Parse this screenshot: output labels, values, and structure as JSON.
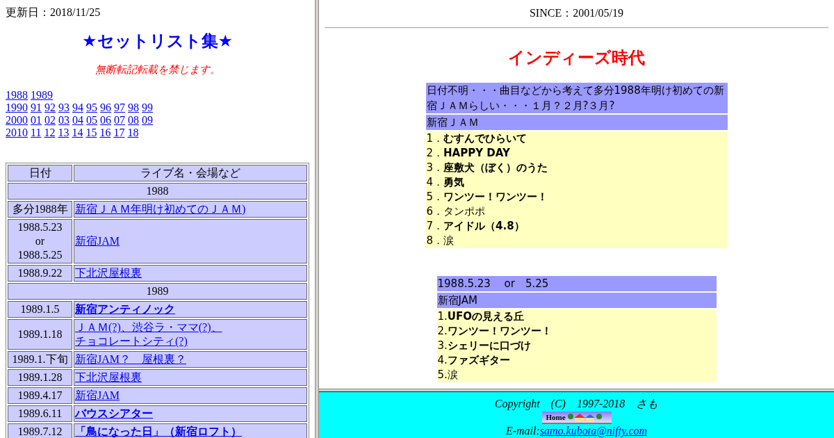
{
  "left_frame": {
    "updated": "更新日：2018/11/25",
    "title": "★セットリスト集★",
    "notice": "無断転記転載を禁じます。",
    "year_links": [
      [
        "1988",
        "1989"
      ],
      [
        "1990",
        "91",
        "92",
        "93",
        "94",
        "95",
        "96",
        "97",
        "98",
        "99"
      ],
      [
        "2000",
        "01",
        "02",
        "03",
        "04",
        "05",
        "06",
        "07",
        "08",
        "09"
      ],
      [
        "2010",
        "11",
        "12",
        "13",
        "14",
        "15",
        "16",
        "17",
        "18"
      ]
    ],
    "table": {
      "columns": [
        "日付",
        "ライブ名・会場など"
      ],
      "rows": [
        {
          "kind": "year",
          "label": "1988"
        },
        {
          "kind": "live",
          "date": [
            "多分1988年"
          ],
          "venue": [
            "新宿ＪＡＭ年明け初めてのＪＡＭ)"
          ],
          "bold": false
        },
        {
          "kind": "live",
          "date": [
            "1988.5.23",
            "or",
            "1988.5.25"
          ],
          "venue": [
            "新宿JAM"
          ],
          "bold": false
        },
        {
          "kind": "live",
          "date": [
            "1988.9.22"
          ],
          "venue": [
            "下北沢屋根裏"
          ],
          "bold": false
        },
        {
          "kind": "year",
          "label": "1989"
        },
        {
          "kind": "live",
          "date": [
            "1989.1.5"
          ],
          "venue": [
            "新宿アンティノック"
          ],
          "bold": true
        },
        {
          "kind": "live",
          "date": [
            "1989.1.18"
          ],
          "venue": [
            "ＪＡＭ(?)、渋谷ラ・ママ(?)、",
            "チョコレートシティ(?)"
          ],
          "bold": false
        },
        {
          "kind": "live",
          "date": [
            "1989.1.下旬"
          ],
          "venue": [
            "新宿JAM？　屋根裏？"
          ],
          "bold": false
        },
        {
          "kind": "live",
          "date": [
            "1989.1.28"
          ],
          "venue": [
            "下北沢屋根裏"
          ],
          "bold": false
        },
        {
          "kind": "live",
          "date": [
            "1989.4.17"
          ],
          "venue": [
            "新宿JAM"
          ],
          "bold": false
        },
        {
          "kind": "live",
          "date": [
            "1989.6.11"
          ],
          "venue": [
            "バウスシアター"
          ],
          "bold": true
        },
        {
          "kind": "live",
          "date": [
            "1989.7.12"
          ],
          "venue": [
            "「鳥になった日」（新宿ロフト）"
          ],
          "bold": true
        }
      ]
    }
  },
  "main_frame": {
    "since": "SINCE：2001/05/19",
    "heading": "インディーズ時代",
    "setlists": [
      {
        "date": "日付不明・・・曲目などから考えて多分1988年明け初めての新宿ＪＡＭらしい・・・１月？２月?３月?",
        "venue": "新宿ＪＡＭ",
        "songs": [
          "1．**むすんでひらいて**",
          "2．**HAPPY DAY**",
          "3．**座敷犬（ぼく）のうた**",
          "4．**勇気**",
          "5．**ワンツー！ワンツー！**",
          "6．タンポポ",
          "7．**アイドル（4.8）**",
          "8．涙"
        ]
      },
      {
        "date": "1988.5.23　 or　5.25",
        "venue": "新宿JAM",
        "songs": [
          "1.**UFOの見える丘**",
          "2.**ワンツー！ワンツー！**",
          "3.**シェリーに口づけ**",
          "4.**ファズギター**",
          "5.涙"
        ]
      }
    ]
  },
  "footer": {
    "copyright": "Copyright　(C)　1997-2018　さも",
    "home": "Home",
    "email_label": "E-mail:",
    "email": "samo.kubota@nifty.com"
  }
}
